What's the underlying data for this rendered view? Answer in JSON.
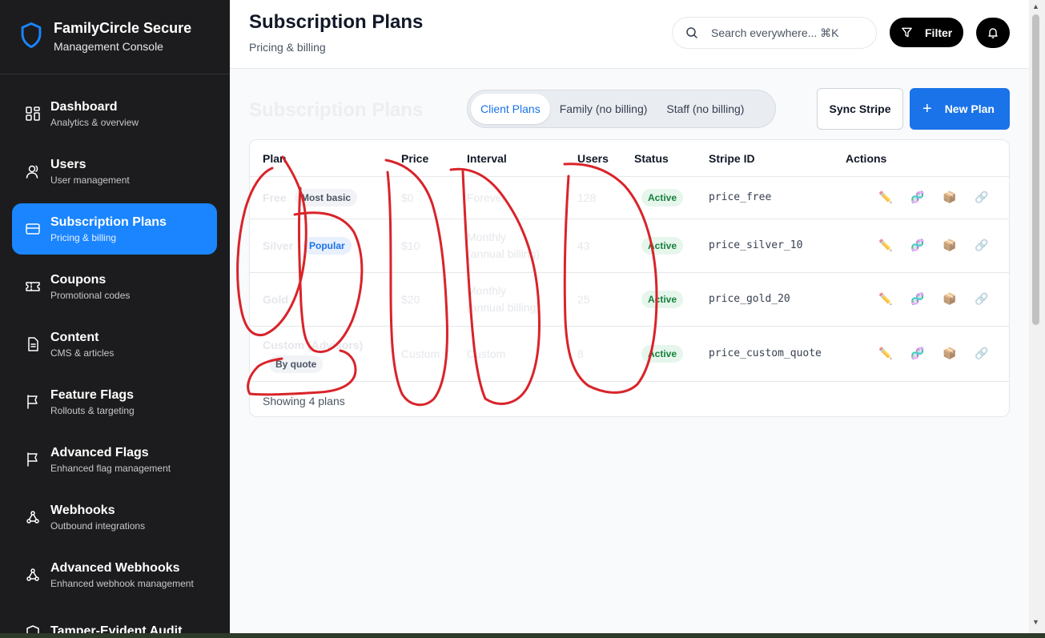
{
  "brand": {
    "title": "FamilyCircle Secure",
    "subtitle": "Management Console"
  },
  "nav": [
    {
      "label": "Dashboard",
      "sub": "Analytics & overview",
      "icon": "grid-icon"
    },
    {
      "label": "Users",
      "sub": "User management",
      "icon": "user-icon"
    },
    {
      "label": "Subscription Plans",
      "sub": "Pricing & billing",
      "icon": "credit-card-icon",
      "active": true
    },
    {
      "label": "Coupons",
      "sub": "Promotional codes",
      "icon": "ticket-icon"
    },
    {
      "label": "Content",
      "sub": "CMS & articles",
      "icon": "document-icon"
    },
    {
      "label": "Feature Flags",
      "sub": "Rollouts & targeting",
      "icon": "flag-icon"
    },
    {
      "label": "Advanced Flags",
      "sub": "Enhanced flag management",
      "icon": "flag-icon"
    },
    {
      "label": "Webhooks",
      "sub": "Outbound integrations",
      "icon": "webhook-icon"
    },
    {
      "label": "Advanced Webhooks",
      "sub": "Enhanced webhook management",
      "icon": "webhook-icon"
    },
    {
      "label": "Tamper-Evident Audit",
      "sub": "",
      "icon": "audit-icon"
    }
  ],
  "header": {
    "title": "Subscription Plans",
    "subtitle": "Pricing & billing",
    "search_placeholder": "Search everywhere... ⌘K",
    "filter_label": "Filter"
  },
  "main": {
    "ghost_title": "Subscription Plans",
    "tabs": [
      "Client Plans",
      "Family (no billing)",
      "Staff (no billing)"
    ],
    "active_tab": 0,
    "sync_label": "Sync Stripe",
    "new_label": "New Plan",
    "columns": [
      "Plan",
      "Price",
      "Interval",
      "Users",
      "Status",
      "Stripe ID",
      "Actions"
    ],
    "rows": [
      {
        "plan": "Free",
        "badge": "Most basic",
        "badge_style": "gray",
        "price": "$0",
        "interval": "Forever",
        "interval2": "",
        "users": "128",
        "status": "Active",
        "stripe_id": "price_free"
      },
      {
        "plan": "Silver",
        "badge": "Popular",
        "badge_style": "blue",
        "price": "$10",
        "interval": "Monthly",
        "interval2": "(annual billing)",
        "users": "43",
        "status": "Active",
        "stripe_id": "price_silver_10"
      },
      {
        "plan": "Gold",
        "badge": "",
        "badge_style": "",
        "price": "$20",
        "interval": "Monthly",
        "interval2": "(annual billing)",
        "users": "25",
        "status": "Active",
        "stripe_id": "price_gold_20"
      },
      {
        "plan": "Custom (Advisors)",
        "badge": "By quote",
        "badge_style": "gray",
        "price": "Custom",
        "interval": "Custom",
        "interval2": "",
        "users": "8",
        "status": "Active",
        "stripe_id": "price_custom_quote"
      }
    ],
    "action_icons": [
      "✏️",
      "🧬",
      "📦",
      "🔗"
    ],
    "footer": "Showing 4 plans"
  }
}
